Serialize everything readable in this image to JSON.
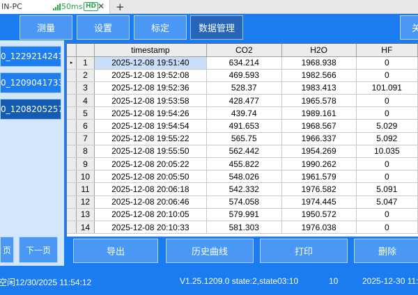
{
  "tab": {
    "title": "IN-PC",
    "latency": "50ms",
    "hd": "HD",
    "close": "✕",
    "add": "+"
  },
  "toolbar": {
    "measure": "测量",
    "settings": "设置",
    "calibrate": "标定",
    "data_mgmt": "数据管理",
    "right_partial": "关"
  },
  "files": [
    "0_1229214241",
    "0_1209041733",
    "0_1208205257"
  ],
  "pager": {
    "prev": "页",
    "next": "下一页"
  },
  "table": {
    "headers": [
      "",
      "",
      "timestamp",
      "CO2",
      "H2O",
      "HF"
    ],
    "rows": [
      [
        "▸",
        "1",
        "2025-12-08 19:51:40",
        "634.214",
        "1968.938",
        "0"
      ],
      [
        "",
        "2",
        "2025-12-08 19:52:08",
        "469.593",
        "1982.566",
        "0"
      ],
      [
        "",
        "3",
        "2025-12-08 19:52:36",
        "528.37",
        "1983.413",
        "101.091"
      ],
      [
        "",
        "4",
        "2025-12-08 19:53:58",
        "428.477",
        "1965.578",
        "0"
      ],
      [
        "",
        "5",
        "2025-12-08 19:54:26",
        "439.74",
        "1989.161",
        "0"
      ],
      [
        "",
        "6",
        "2025-12-08 19:54:54",
        "491.653",
        "1968.567",
        "5.029"
      ],
      [
        "",
        "7",
        "2025-12-08 19:55:22",
        "565.75",
        "1966.337",
        "5.092"
      ],
      [
        "",
        "8",
        "2025-12-08 19:55:50",
        "562.442",
        "1954.269",
        "10.035"
      ],
      [
        "",
        "9",
        "2025-12-08 20:05:22",
        "455.822",
        "1990.262",
        "0"
      ],
      [
        "",
        "10",
        "2025-12-08 20:05:50",
        "548.026",
        "1961.579",
        "0"
      ],
      [
        "",
        "11",
        "2025-12-08 20:06:18",
        "542.332",
        "1976.582",
        "5.091"
      ],
      [
        "",
        "12",
        "2025-12-08 20:06:46",
        "574.058",
        "1974.445",
        "5.047"
      ],
      [
        "",
        "13",
        "2025-12-08 20:10:05",
        "579.991",
        "1950.572",
        "0"
      ],
      [
        "",
        "14",
        "2025-12-08 20:10:33",
        "581.303",
        "1976.038",
        "0"
      ]
    ]
  },
  "actions": {
    "export": "导出",
    "history": "历史曲线",
    "print": "打印",
    "delete": "删除"
  },
  "status": {
    "left": "空闲12/30/2025 11:54:12",
    "version": "V1.25.1209.0 state:2,state03:10",
    "count": "10",
    "date": "2025-12-30 11:"
  },
  "colors": {
    "background": "#1a7cf0",
    "button": "#4a98f3",
    "button_active": "#2665b8",
    "panel": "#d3e7fb",
    "selected_cell": "#c9def8"
  }
}
